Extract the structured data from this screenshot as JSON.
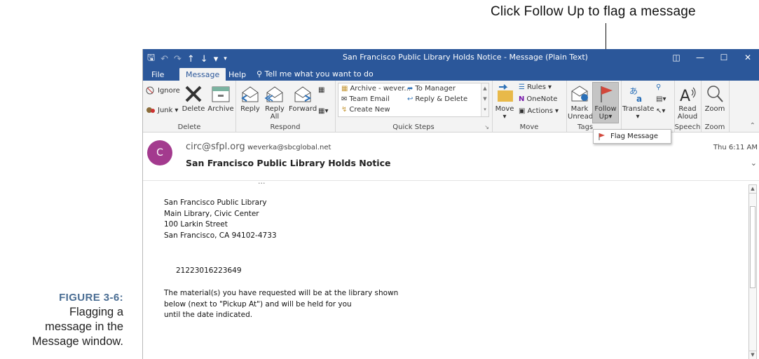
{
  "annotation": {
    "callout": "Click Follow Up to flag a message"
  },
  "caption": {
    "figure": "FIGURE 3-6:",
    "line1": "Flagging a",
    "line2": "message in the",
    "line3": "Message window."
  },
  "titlebar": {
    "title": "San Francisco Public Library Holds Notice  -  Message (Plain Text)"
  },
  "tabs": {
    "file": "File",
    "message": "Message",
    "help": "Help",
    "tell_me": "Tell me what you want to do"
  },
  "ribbon": {
    "delete_group": {
      "ignore": "Ignore",
      "junk": "Junk",
      "delete": "Delete",
      "archive": "Archive",
      "label": "Delete"
    },
    "respond_group": {
      "reply": "Reply",
      "reply_all_1": "Reply",
      "reply_all_2": "All",
      "forward": "Forward",
      "label": "Respond"
    },
    "quick_steps": {
      "archive": "Archive - wever...",
      "team_email": "Team Email",
      "create_new": "Create New",
      "to_manager": "To Manager",
      "reply_delete": "Reply & Delete",
      "label": "Quick Steps"
    },
    "move_group": {
      "move": "Move",
      "rules": "Rules",
      "onenote": "OneNote",
      "actions": "Actions",
      "label": "Move"
    },
    "tags_group": {
      "mark_unread_1": "Mark",
      "mark_unread_2": "Unread",
      "follow_up_1": "Follow",
      "follow_up_2": "Up",
      "label": "Tags"
    },
    "editing_group": {
      "translate": "Translate"
    },
    "speech_group": {
      "read_aloud_1": "Read",
      "read_aloud_2": "Aloud",
      "label": "Speech"
    },
    "zoom_group": {
      "zoom": "Zoom",
      "label": "Zoom"
    }
  },
  "dropdown": {
    "flag_message": "Flag Message"
  },
  "message": {
    "avatar_initial": "C",
    "from": "circ@sfpl.org",
    "to": "weverka@sbcglobal.net",
    "subject": "San Francisco Public Library Holds Notice",
    "time": "Thu 6:11 AM",
    "body": {
      "addr1": "San Francisco Public Library",
      "addr2": "Main Library, Civic Center",
      "addr3": "100 Larkin Street",
      "addr4": "San Francisco, CA  94102-4733",
      "barcode": "21223016223649",
      "p1": "The material(s) you have requested will be at the library shown",
      "p2": "below (next to \"Pickup At\") and will be held for you",
      "p3": "until the date indicated."
    }
  },
  "colors": {
    "title_bar": "#2b579a",
    "avatar": "#a33a8e",
    "flag": "#d2473b",
    "caption_figure": "#4a6d93"
  }
}
